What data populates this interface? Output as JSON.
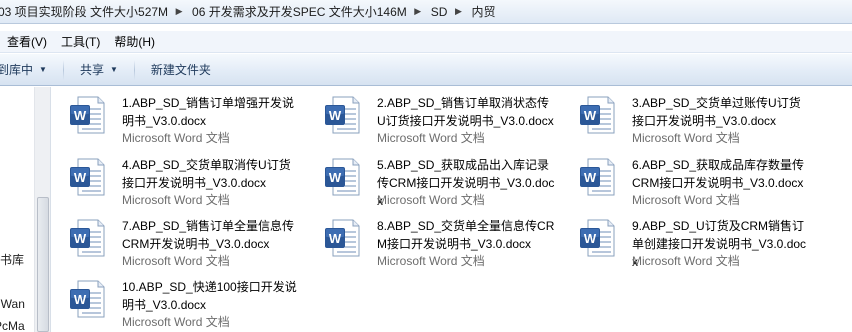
{
  "address": {
    "crumbs": [
      "03 项目实现阶段 文件大小527M",
      "06 开发需求及开发SPEC 文件大小146M",
      "SD",
      "内贸"
    ]
  },
  "menu": {
    "items": [
      "查看(V)",
      "工具(T)",
      "帮助(H)"
    ]
  },
  "toolbar": {
    "include_label": "到库中",
    "share_label": "共享",
    "new_folder_label": "新建文件夹"
  },
  "navpane": {
    "items": [
      "书库",
      "gWan",
      "PcMa"
    ]
  },
  "files": [
    {
      "name": "1.ABP_SD_销售订单增强开发说明书_V3.0.docx",
      "type": "Microsoft Word 文档"
    },
    {
      "name": "2.ABP_SD_销售订单取消状态传U订货接口开发说明书_V3.0.docx",
      "type": "Microsoft Word 文档"
    },
    {
      "name": "3.ABP_SD_交货单过账传U订货接口开发说明书_V3.0.docx",
      "type": "Microsoft Word 文档"
    },
    {
      "name": "4.ABP_SD_交货单取消传U订货接口开发说明书_V3.0.docx",
      "type": "Microsoft Word 文档"
    },
    {
      "name": "5.ABP_SD_获取成品出入库记录传CRM接口开发说明书_V3.0.docx",
      "type": "Microsoft Word 文档"
    },
    {
      "name": "6.ABP_SD_获取成品库存数量传CRM接口开发说明书_V3.0.docx",
      "type": "Microsoft Word 文档"
    },
    {
      "name": "7.ABP_SD_销售订单全量信息传CRM开发说明书_V3.0.docx",
      "type": "Microsoft Word 文档"
    },
    {
      "name": "8.ABP_SD_交货单全量信息传CRM接口开发说明书_V3.0.docx",
      "type": "Microsoft Word 文档"
    },
    {
      "name": "9.ABP_SD_U订货及CRM销售订单创建接口开发说明书_V3.0.docx",
      "type": "Microsoft Word 文档"
    },
    {
      "name": "10.ABP_SD_快递100接口开发说明书_V3.0.docx",
      "type": "Microsoft Word 文档"
    }
  ],
  "colors": {
    "word_blue": "#2b5797",
    "word_blue_light": "#4a7cc4",
    "type_text": "#6d6d6d"
  }
}
